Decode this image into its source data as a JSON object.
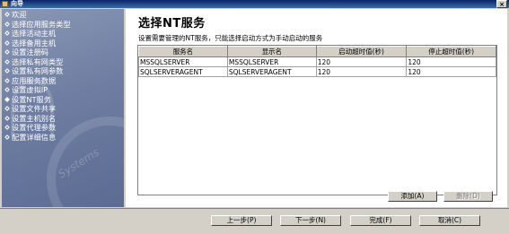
{
  "window": {
    "title": "向导",
    "close_label": "×"
  },
  "sidebar": {
    "watermark": "Systems",
    "items": [
      {
        "label": "欢迎"
      },
      {
        "label": "选择应用服务类型"
      },
      {
        "label": "选择活动主机"
      },
      {
        "label": "选择备用主机"
      },
      {
        "label": "设置注册码"
      },
      {
        "label": "选择私有网类型"
      },
      {
        "label": "设置私有网参数"
      },
      {
        "label": "应用服务数据"
      },
      {
        "label": "设置虚拟IP"
      },
      {
        "label": "设置NT服务"
      },
      {
        "label": "设置文件共享"
      },
      {
        "label": "设置主机别名"
      },
      {
        "label": "设置代理参数"
      },
      {
        "label": "配置详细信息"
      }
    ]
  },
  "main": {
    "heading": "选择NT服务",
    "instruction": "设置需要管理的NT服务，只能选择启动方式为手动启动的服务",
    "table": {
      "columns": [
        "服务名",
        "显示名",
        "启动超时值(秒)",
        "停止超时值(秒)"
      ],
      "rows": [
        [
          "MSSQLSERVER",
          "MSSQLSERVER",
          "120",
          "120"
        ],
        [
          "SQLSERVERAGENT",
          "SQLSERVERAGENT",
          "120",
          "120"
        ]
      ]
    },
    "add_button": "添加(A)",
    "delete_button": "删除(D)"
  },
  "footer": {
    "back_button": "上一步(P)",
    "next_button": "下一步(N)",
    "finish_button": "完成(F)",
    "cancel_button": "取消(C)"
  }
}
